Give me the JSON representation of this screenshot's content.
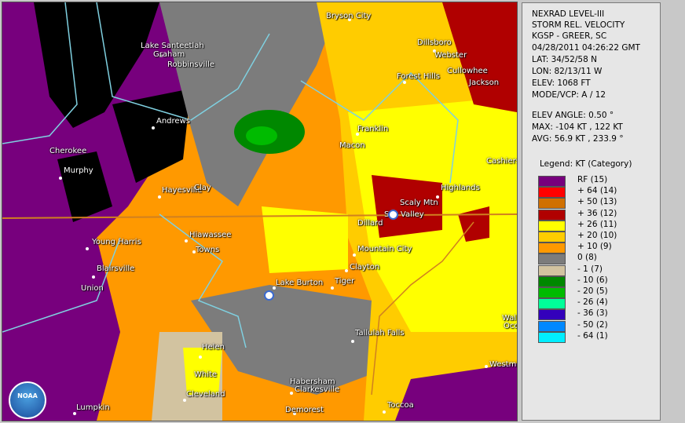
{
  "panel": {
    "lines": [
      "NEXRAD LEVEL-III",
      "STORM REL. VELOCITY",
      "KGSP - GREER, SC",
      "04/28/2011 04:26:22 GMT",
      "LAT: 34/52/58 N",
      "LON: 82/13/11 W",
      "ELEV: 1068 FT",
      "MODE/VCP: A / 12"
    ],
    "lines2": [
      "ELEV ANGLE: 0.50 °",
      "MAX: -104 KT , 122 KT",
      "AVG: 56.9 KT , 233.9 °"
    ],
    "legend_title": "Legend: KT (Category)",
    "legend": [
      {
        "label": "RF  (15)",
        "color": "#77007d"
      },
      {
        "label": "+ 64  (14)",
        "color": "#ff0000"
      },
      {
        "label": "+ 50  (13)",
        "color": "#d07000"
      },
      {
        "label": "+ 36  (12)",
        "color": "#b00000"
      },
      {
        "label": "+ 26  (11)",
        "color": "#ffff00"
      },
      {
        "label": "+ 20  (10)",
        "color": "#ffcc00"
      },
      {
        "label": "+ 10  (9)",
        "color": "#ff9900"
      },
      {
        "label": "0  (8)",
        "color": "#7c7c7c"
      },
      {
        "label": "- 1  (7)",
        "color": "#d2c3a0"
      },
      {
        "label": "- 10  (6)",
        "color": "#008800"
      },
      {
        "label": "- 20  (5)",
        "color": "#00bb00"
      },
      {
        "label": "- 26  (4)",
        "color": "#00ff99"
      },
      {
        "label": "- 36  (3)",
        "color": "#3300bb"
      },
      {
        "label": "- 50  (2)",
        "color": "#0088ff"
      },
      {
        "label": "- 64  (1)",
        "color": "#00eeff"
      }
    ]
  },
  "cities": [
    "Bryson City",
    "Lake Santeetlah",
    "Graham",
    "Robbinsville",
    "Dillsboro",
    "Webster",
    "Forest Hills",
    "Cullowhee",
    "Jackson",
    "Andrews",
    "Franklin",
    "Macon",
    "Cherokee",
    "Murphy",
    "Cashiers",
    "Hayesville",
    "Clay",
    "Highlands",
    "Scaly Mtn",
    "Sky Valley",
    "Dillard",
    "Hiawassee",
    "Young Harris",
    "Towns",
    "Mountain City",
    "Clayton",
    "Blairsville",
    "Union",
    "Lake Burton",
    "Tiger",
    "Tallulah Falls",
    "Helen",
    "White",
    "Westmi",
    "Habersham",
    "Clarkesville",
    "Cleveland",
    "Demorest",
    "Toccoa",
    "Lumpkin",
    "Wal",
    "Oco"
  ],
  "logo": "NOAA",
  "icons": [
    "noaa-logo-icon",
    "radar-site-icon"
  ]
}
